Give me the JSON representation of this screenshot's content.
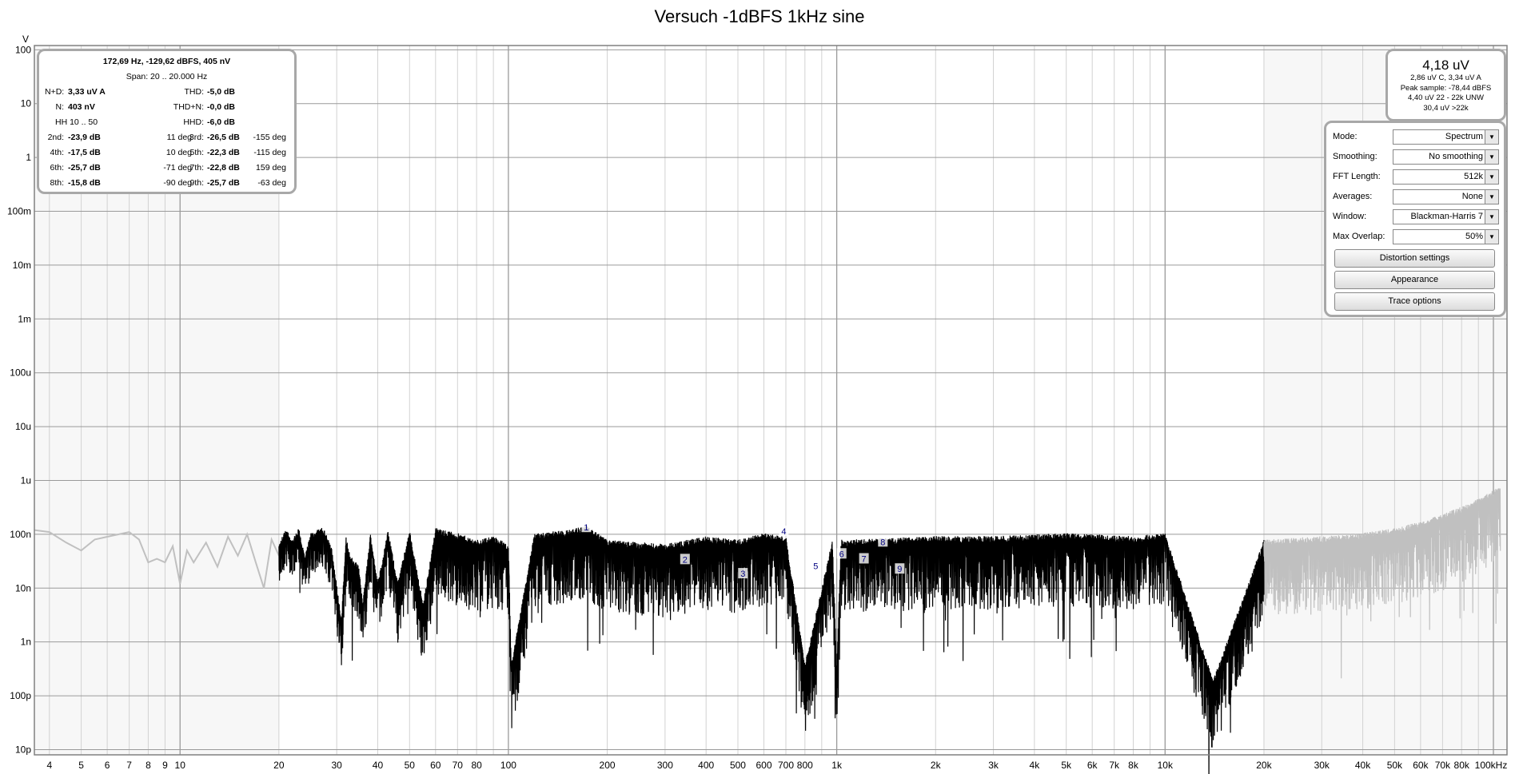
{
  "chart_data": {
    "type": "line",
    "title": "Versuch -1dBFS 1kHz sine",
    "ylabel": "V",
    "xlabel": "",
    "x_scale": "log",
    "y_scale": "log",
    "xlim": [
      3.6,
      110000
    ],
    "ylim": [
      8e-12,
      120
    ],
    "grid": true,
    "y_ticks": [
      {
        "v": 100,
        "label": "100"
      },
      {
        "v": 10,
        "label": "10"
      },
      {
        "v": 1,
        "label": "1"
      },
      {
        "v": 0.1,
        "label": "100m"
      },
      {
        "v": 0.01,
        "label": "10m"
      },
      {
        "v": 0.001,
        "label": "1m"
      },
      {
        "v": 0.0001,
        "label": "100u"
      },
      {
        "v": 1e-05,
        "label": "10u"
      },
      {
        "v": 1e-06,
        "label": "1u"
      },
      {
        "v": 1e-07,
        "label": "100n"
      },
      {
        "v": 1e-08,
        "label": "10n"
      },
      {
        "v": 1e-09,
        "label": "1n"
      },
      {
        "v": 1e-10,
        "label": "100p"
      },
      {
        "v": 1e-11,
        "label": "10p"
      }
    ],
    "x_ticks": [
      {
        "v": 4,
        "label": "4"
      },
      {
        "v": 5,
        "label": "5"
      },
      {
        "v": 6,
        "label": "6"
      },
      {
        "v": 7,
        "label": "7"
      },
      {
        "v": 8,
        "label": "8"
      },
      {
        "v": 9,
        "label": "9"
      },
      {
        "v": 10,
        "label": "10"
      },
      {
        "v": 20,
        "label": "20"
      },
      {
        "v": 30,
        "label": "30"
      },
      {
        "v": 40,
        "label": "40"
      },
      {
        "v": 50,
        "label": "50"
      },
      {
        "v": 60,
        "label": "60"
      },
      {
        "v": 70,
        "label": "70"
      },
      {
        "v": 80,
        "label": "80"
      },
      {
        "v": 100,
        "label": "100"
      },
      {
        "v": 200,
        "label": "200"
      },
      {
        "v": 300,
        "label": "300"
      },
      {
        "v": 400,
        "label": "400"
      },
      {
        "v": 500,
        "label": "500"
      },
      {
        "v": 600,
        "label": "600"
      },
      {
        "v": 700,
        "label": "700"
      },
      {
        "v": 800,
        "label": "800"
      },
      {
        "v": 1000,
        "label": "1k"
      },
      {
        "v": 2000,
        "label": "2k"
      },
      {
        "v": 3000,
        "label": "3k"
      },
      {
        "v": 4000,
        "label": "4k"
      },
      {
        "v": 5000,
        "label": "5k"
      },
      {
        "v": 6000,
        "label": "6k"
      },
      {
        "v": 7000,
        "label": "7k"
      },
      {
        "v": 8000,
        "label": "8k"
      },
      {
        "v": 10000,
        "label": "10k"
      },
      {
        "v": 20000,
        "label": "20k"
      },
      {
        "v": 30000,
        "label": "30k"
      },
      {
        "v": 40000,
        "label": "40k"
      },
      {
        "v": 50000,
        "label": "50k"
      },
      {
        "v": 60000,
        "label": "60k"
      },
      {
        "v": 70000,
        "label": "70k"
      },
      {
        "v": 80000,
        "label": "80k"
      },
      {
        "v": 100000,
        "label": "100kHz"
      }
    ],
    "span_hz": [
      20,
      20000
    ],
    "series": [
      {
        "color": "#c0c0c0",
        "x": [
          3.6,
          4,
          4.5,
          5,
          5.5,
          6,
          7,
          7.5,
          8,
          8.5,
          9,
          9.5,
          10,
          10.5,
          11,
          12,
          13,
          14,
          15,
          16,
          17,
          18,
          19,
          20
        ],
        "y": [
          1.2e-07,
          1.1e-07,
          7e-08,
          5e-08,
          8e-08,
          9e-08,
          1.1e-07,
          8e-08,
          3e-08,
          3.5e-08,
          3e-08,
          6e-08,
          1.2e-08,
          5e-08,
          3e-08,
          7e-08,
          2.5e-08,
          9e-08,
          4e-08,
          1e-07,
          3e-08,
          1e-08,
          8e-08,
          4e-08
        ]
      },
      {
        "color": "#000000",
        "x": [
          20,
          21,
          22,
          23,
          24,
          25,
          27,
          28,
          29,
          31,
          32,
          33,
          35,
          36,
          38,
          40,
          43,
          46,
          50,
          55,
          60,
          70,
          80,
          90,
          100,
          102,
          120,
          150,
          172.69,
          200,
          300,
          400,
          500,
          600,
          700,
          800,
          970,
          1000,
          1030,
          2000,
          3000,
          5000,
          8000,
          10000,
          14000,
          20000
        ],
        "y": [
          5e-08,
          1e-07,
          6e-08,
          1e-07,
          3e-08,
          8e-08,
          1e-07,
          8e-08,
          4e-08,
          2e-09,
          7e-08,
          3e-08,
          2e-08,
          4e-09,
          8e-08,
          1e-08,
          9e-08,
          1e-08,
          9e-08,
          4e-09,
          1e-07,
          8e-08,
          6e-08,
          7e-08,
          5e-08,
          3e-10,
          8e-08,
          9e-08,
          1.1e-07,
          6e-08,
          5e-08,
          7e-08,
          6e-08,
          8e-08,
          7e-08,
          3e-10,
          6e-08,
          2.5e-10,
          6e-08,
          7e-08,
          7e-08,
          8e-08,
          7e-08,
          8e-08,
          1.5e-10,
          6e-08
        ]
      },
      {
        "color": "#c0c0c0",
        "x": [
          20000,
          30000,
          40000,
          50000,
          60000,
          70000,
          80000,
          90000,
          100000,
          105000
        ],
        "y": [
          6e-08,
          7e-08,
          8e-08,
          1e-07,
          1.3e-07,
          1.8e-07,
          2.5e-07,
          3.5e-07,
          5e-07,
          6e-07
        ]
      }
    ],
    "harmonic_markers": [
      {
        "label": "1",
        "x": 172.69,
        "y": 1.3e-07
      },
      {
        "label": "2",
        "x": 345,
        "y": 3.3e-08
      },
      {
        "label": "3",
        "x": 518,
        "y": 1.8e-08
      },
      {
        "label": "4",
        "x": 690,
        "y": 1.1e-07
      },
      {
        "label": "5",
        "x": 863,
        "y": 2.5e-08
      },
      {
        "label": "6",
        "x": 1035,
        "y": 4.2e-08
      },
      {
        "label": "7",
        "x": 1210,
        "y": 3.4e-08
      },
      {
        "label": "8",
        "x": 1382,
        "y": 7e-08
      },
      {
        "label": "9",
        "x": 1555,
        "y": 2.2e-08
      }
    ]
  },
  "stats": {
    "cursor_readout": "172,69 Hz, -129,62 dBFS, 405 nV",
    "span": "Span: 20 .. 20.000 Hz",
    "nd_label": "N+D:",
    "nd_value": "3,33 uV A",
    "thd_label": "THD:",
    "thd_value": "-5,0 dB",
    "n_label": "N:",
    "n_value": "403 nV",
    "thdn_label": "THD+N:",
    "thdn_value": "-0,0 dB",
    "hh_label": "HH 10 .. 50",
    "hhd_label": "HHD:",
    "hhd_value": "-6,0 dB",
    "harmonics": [
      {
        "l1": "2nd:",
        "v1": "-23,9 dB",
        "d1": "11 deg",
        "l2": "3rd:",
        "v2": "-26,5 dB",
        "d2": "-155 deg"
      },
      {
        "l1": "4th:",
        "v1": "-17,5 dB",
        "d1": "10 deg",
        "l2": "5th:",
        "v2": "-22,3 dB",
        "d2": "-115 deg"
      },
      {
        "l1": "6th:",
        "v1": "-25,7 dB",
        "d1": "-71 deg",
        "l2": "7th:",
        "v2": "-22,8 dB",
        "d2": "159 deg"
      },
      {
        "l1": "8th:",
        "v1": "-15,8 dB",
        "d1": "-90 deg",
        "l2": "9th:",
        "v2": "-25,7 dB",
        "d2": "-63 deg"
      }
    ]
  },
  "level": {
    "main": "4,18 uV",
    "line1": "2,86 uV C, 3,34 uV A",
    "line2": "Peak sample: -78,44 dBFS",
    "line3": "4,40 uV 22 - 22k UNW",
    "line4": "30,4 uV >22k"
  },
  "controls": {
    "mode_label": "Mode:",
    "mode_value": "Spectrum",
    "smoothing_label": "Smoothing:",
    "smoothing_value": "No  smoothing",
    "fft_label": "FFT Length:",
    "fft_value": "512k",
    "averages_label": "Averages:",
    "averages_value": "None",
    "window_label": "Window:",
    "window_value": "Blackman-Harris 7",
    "overlap_label": "Max Overlap:",
    "overlap_value": "50%",
    "distortion_button": "Distortion settings",
    "appearance_button": "Appearance",
    "trace_button": "Trace options"
  }
}
